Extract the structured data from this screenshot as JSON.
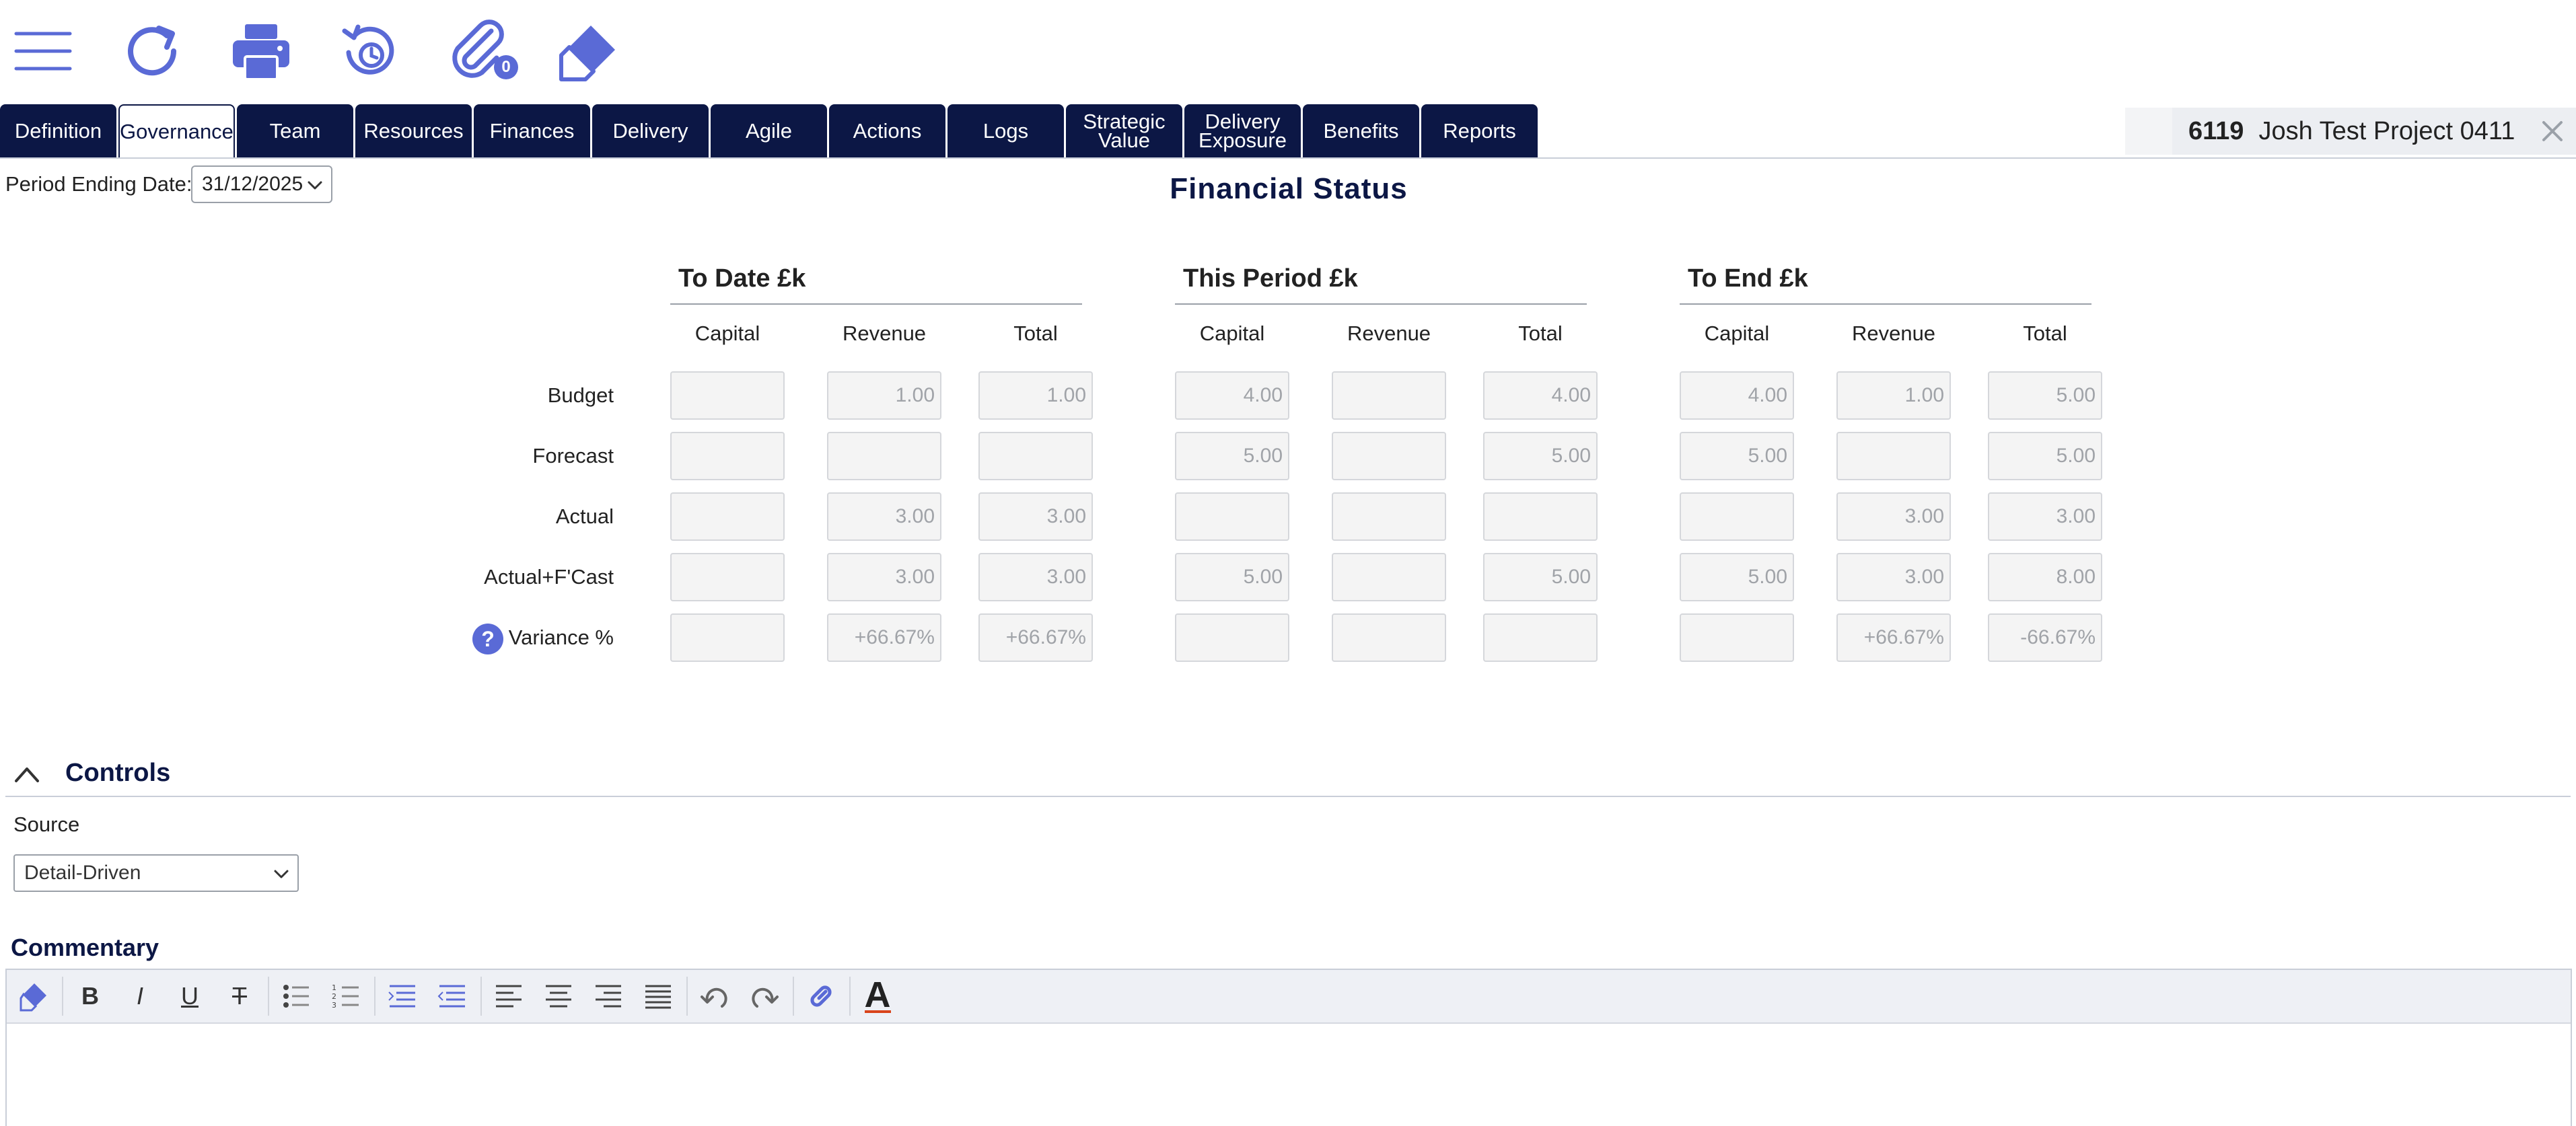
{
  "toolbar": {
    "icons": [
      "menu-icon",
      "refresh-icon",
      "print-icon",
      "history-icon",
      "attachment-icon",
      "eraser-icon"
    ],
    "attachment_count": "0"
  },
  "tabs": [
    {
      "label": "Definition",
      "active": false
    },
    {
      "label": "Governance",
      "active": true
    },
    {
      "label": "Team",
      "active": false
    },
    {
      "label": "Resources",
      "active": false
    },
    {
      "label": "Finances",
      "active": false
    },
    {
      "label": "Delivery",
      "active": false
    },
    {
      "label": "Agile",
      "active": false
    },
    {
      "label": "Actions",
      "active": false
    },
    {
      "label": "Logs",
      "active": false
    },
    {
      "label": "Strategic Value",
      "active": false
    },
    {
      "label": "Delivery Exposure",
      "active": false
    },
    {
      "label": "Benefits",
      "active": false
    },
    {
      "label": "Reports",
      "active": false
    }
  ],
  "project": {
    "id": "6119",
    "name": "Josh Test Project 0411"
  },
  "period": {
    "label": "Period Ending Date:",
    "value": "31/12/2025"
  },
  "financial": {
    "title": "Financial Status",
    "groups": [
      "To Date £k",
      "This Period £k",
      "To End £k"
    ],
    "columns": [
      "Capital",
      "Revenue",
      "Total"
    ],
    "rows": [
      {
        "label": "Budget",
        "values": [
          "",
          "1.00",
          "1.00",
          "4.00",
          "",
          "4.00",
          "4.00",
          "1.00",
          "5.00"
        ]
      },
      {
        "label": "Forecast",
        "values": [
          "",
          "",
          "",
          "5.00",
          "",
          "5.00",
          "5.00",
          "",
          "5.00"
        ]
      },
      {
        "label": "Actual",
        "values": [
          "",
          "3.00",
          "3.00",
          "",
          "",
          "",
          "",
          "3.00",
          "3.00"
        ]
      },
      {
        "label": "Actual+F'Cast",
        "values": [
          "",
          "3.00",
          "3.00",
          "5.00",
          "",
          "5.00",
          "5.00",
          "3.00",
          "8.00"
        ]
      },
      {
        "label": "Variance %",
        "values": [
          "",
          "+66.67%",
          "+66.67%",
          "",
          "",
          "",
          "",
          "+66.67%",
          "-66.67%"
        ]
      }
    ]
  },
  "controls": {
    "title": "Controls",
    "source_label": "Source",
    "source_value": "Detail-Driven"
  },
  "commentary": {
    "title": "Commentary",
    "toolbar": [
      "eraser-icon",
      "bold",
      "italic",
      "underline",
      "strikethrough",
      "bullet-list-icon",
      "numbered-list-icon",
      "indent-icon",
      "outdent-icon",
      "align-left-icon",
      "align-center-icon",
      "align-right-icon",
      "justify-icon",
      "undo-icon",
      "redo-icon",
      "link-icon",
      "font-color-icon"
    ],
    "labels": {
      "bold": "B",
      "italic": "I",
      "underline": "U",
      "strike": "T",
      "color": "A"
    }
  }
}
